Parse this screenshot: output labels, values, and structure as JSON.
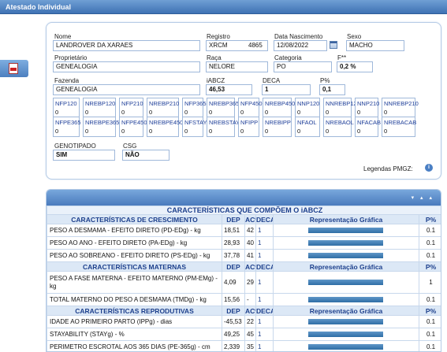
{
  "window": {
    "title": "Atestado Individual"
  },
  "form": {
    "nome": {
      "label": "Nome",
      "value": "LANDROVER DA XARAES"
    },
    "registro": {
      "label": "Registro",
      "prefix": "XRCM",
      "number": "4865"
    },
    "nascimento": {
      "label": "Data Nascimento",
      "value": "12/08/2022"
    },
    "sexo": {
      "label": "Sexo",
      "value": "MACHO"
    },
    "proprietario": {
      "label": "Proprietário",
      "value": "GENEALOGIA"
    },
    "raca": {
      "label": "Raça",
      "value": "NELORE"
    },
    "categoria": {
      "label": "Categoria",
      "value": "PO"
    },
    "f": {
      "label": "F**",
      "value": "0,2 %"
    },
    "fazenda": {
      "label": "Fazenda",
      "value": "GENEALOGIA"
    },
    "iabcz": {
      "label": "iABCZ",
      "value": "46,53"
    },
    "deca": {
      "label": "DECA",
      "value": "1"
    },
    "pct": {
      "label": "P%",
      "value": "0,1"
    },
    "indices_row1": [
      {
        "k": "NFP120",
        "v": "0"
      },
      {
        "k": "NREBP120",
        "v": "0"
      },
      {
        "k": "NFP210",
        "v": "0"
      },
      {
        "k": "NREBP210",
        "v": "0"
      },
      {
        "k": "NFP365",
        "v": "0"
      },
      {
        "k": "NREBP365",
        "v": "0"
      },
      {
        "k": "NFP450",
        "v": "0"
      },
      {
        "k": "NREBP450",
        "v": "0"
      },
      {
        "k": "NNP120",
        "v": "0"
      },
      {
        "k": "NNREBP120",
        "v": "0"
      },
      {
        "k": "NNP210",
        "v": "0"
      },
      {
        "k": "NNREBP210",
        "v": "0"
      }
    ],
    "indices_row2": [
      {
        "k": "NFPE365",
        "v": "0"
      },
      {
        "k": "NREBPE365",
        "v": "0"
      },
      {
        "k": "NFPE450",
        "v": "0"
      },
      {
        "k": "NREBPE450",
        "v": "0"
      },
      {
        "k": "NFSTAY",
        "v": "0"
      },
      {
        "k": "NREBSTAY",
        "v": "0"
      },
      {
        "k": "NFIPP",
        "v": "0"
      },
      {
        "k": "NREBIPP",
        "v": "0"
      },
      {
        "k": "NFAOL",
        "v": "0"
      },
      {
        "k": "NREBAOL",
        "v": "0"
      },
      {
        "k": "NFACAB",
        "v": "0"
      },
      {
        "k": "NREBACAB",
        "v": "0"
      }
    ],
    "genotipado": {
      "label": "GENOTIPADO",
      "value": "SIM"
    },
    "csg": {
      "label": "CSG",
      "value": "NÃO"
    },
    "legendas": "Legendas PMGZ:"
  },
  "table": {
    "title": "CARACTERÍSTICAS QUE COMPÕEM O iABCZ",
    "columns": {
      "dep": "DEP",
      "ac": "AC%",
      "deca": "DECA",
      "graf": "Representação Gráfica",
      "pct": "P%"
    },
    "sections": [
      {
        "name": "CARACTERÍSTICAS DE CRESCIMENTO",
        "rows": [
          {
            "name": "PESO A DESMAMA - EFEITO DIRETO (PD-EDg) - kg",
            "dep": "18,51",
            "ac": "42",
            "deca": "1",
            "pct": "0.1"
          },
          {
            "name": "PESO AO ANO - EFEITO DIRETO (PA-EDg) - kg",
            "dep": "28,93",
            "ac": "40",
            "deca": "1",
            "pct": "0.1"
          },
          {
            "name": "PESO AO SOBREANO - EFEITO DIRETO (PS-EDg) - kg",
            "dep": "37,78",
            "ac": "41",
            "deca": "1",
            "pct": "0.1"
          }
        ]
      },
      {
        "name": "CARACTERÍSTICAS MATERNAS",
        "rows": [
          {
            "name": "PESO A FASE MATERNA - EFEITO MATERNO (PM-EMg) - kg",
            "dep": "4,09",
            "ac": "29",
            "deca": "1",
            "pct": "1"
          },
          {
            "name": "TOTAL MATERNO DO PESO A DESMAMA (TMDg) - kg",
            "dep": "15,56",
            "ac": "-",
            "deca": "1",
            "pct": "0.1"
          }
        ]
      },
      {
        "name": "CARACTERÍSTICAS REPRODUTIVAS",
        "rows": [
          {
            "name": "IDADE AO PRIMEIRO PARTO (IPPg) - dias",
            "dep": "-45,53",
            "ac": "22",
            "deca": "1",
            "pct": "0.1"
          },
          {
            "name": "STAYABILITY (STAYg) - %",
            "dep": "49,25",
            "ac": "45",
            "deca": "1",
            "pct": "0.1"
          },
          {
            "name": "PERIMETRO ESCROTAL AOS 365 DIAS (PE-365g) - cm",
            "dep": "2,339",
            "ac": "35",
            "deca": "1",
            "pct": "0.1"
          }
        ]
      }
    ]
  }
}
